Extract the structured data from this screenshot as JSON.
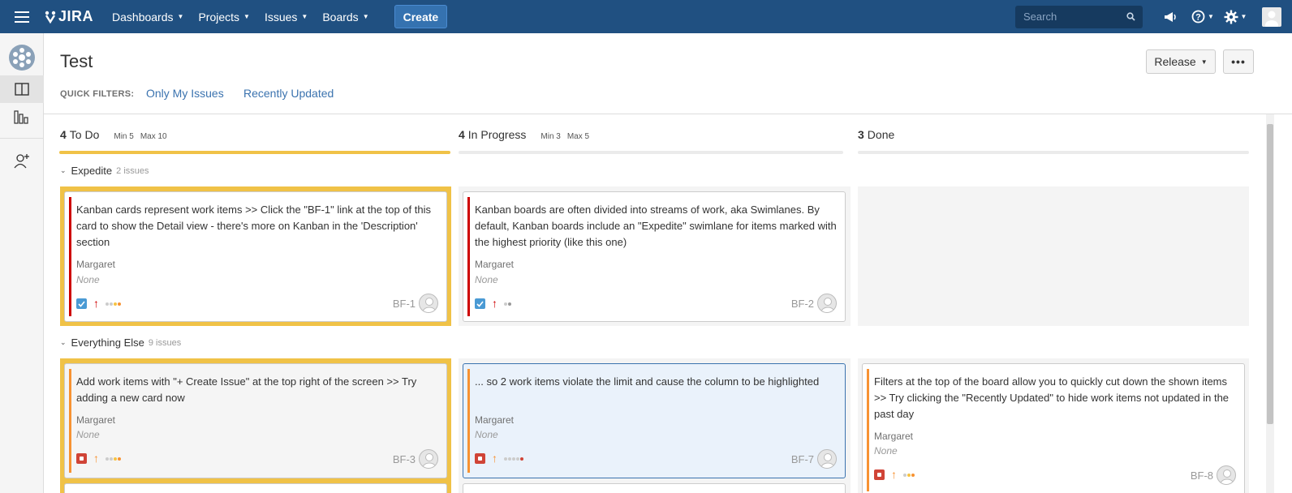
{
  "nav": {
    "logo": "JIRA",
    "items": [
      "Dashboards",
      "Projects",
      "Issues",
      "Boards"
    ],
    "create": "Create",
    "search_placeholder": "Search"
  },
  "board": {
    "title": "Test",
    "release": "Release",
    "more": "•••",
    "quick_filters_label": "QUICK FILTERS:",
    "quick_filters": [
      "Only My Issues",
      "Recently Updated"
    ]
  },
  "columns": [
    {
      "count": "4",
      "name": "To Do",
      "min": "Min 5",
      "max": "Max 10"
    },
    {
      "count": "4",
      "name": "In Progress",
      "min": "Min 3",
      "max": "Max 5"
    },
    {
      "count": "3",
      "name": "Done",
      "min": "",
      "max": ""
    }
  ],
  "swimlanes": [
    {
      "name": "Expedite",
      "issues": "2 issues"
    },
    {
      "name": "Everything Else",
      "issues": "9 issues"
    }
  ],
  "cards": [
    {
      "summary": "Kanban cards represent work items >> Click the \"BF-1\" link at the top of this card to show the Detail view - there's more on Kanban in the 'Description' section",
      "assignee": "Margaret",
      "version": "None",
      "key": "BF-1",
      "type": "task",
      "priority": "highest"
    },
    {
      "summary": "Kanban boards are often divided into streams of work, aka Swimlanes. By default, Kanban boards include an \"Expedite\" swimlane for items marked with the highest priority (like this one)",
      "assignee": "Margaret",
      "version": "None",
      "key": "BF-2",
      "type": "task",
      "priority": "highest"
    },
    {
      "summary": "Add work items with \"+ Create Issue\" at the top right of the screen >> Try adding a new card now",
      "assignee": "Margaret",
      "version": "None",
      "key": "BF-3",
      "type": "bug",
      "priority": "high"
    },
    {
      "summary": "... so 2 work items violate the limit and cause the column to be highlighted",
      "assignee": "Margaret",
      "version": "None",
      "key": "BF-7",
      "type": "bug",
      "priority": "high"
    },
    {
      "summary": "Filters at the top of the board allow you to quickly cut down the shown items >> Try clicking the \"Recently Updated\" to hide work items not updated in the past day",
      "assignee": "Margaret",
      "version": "None",
      "key": "BF-8",
      "type": "bug",
      "priority": "high"
    }
  ],
  "colors": {
    "nav_bg": "#205081",
    "create_btn": "#3572b0",
    "link": "#3b73af",
    "over_limit": "#f0c247",
    "priority_highest": "#ce0000",
    "priority_high": "#f79232"
  }
}
